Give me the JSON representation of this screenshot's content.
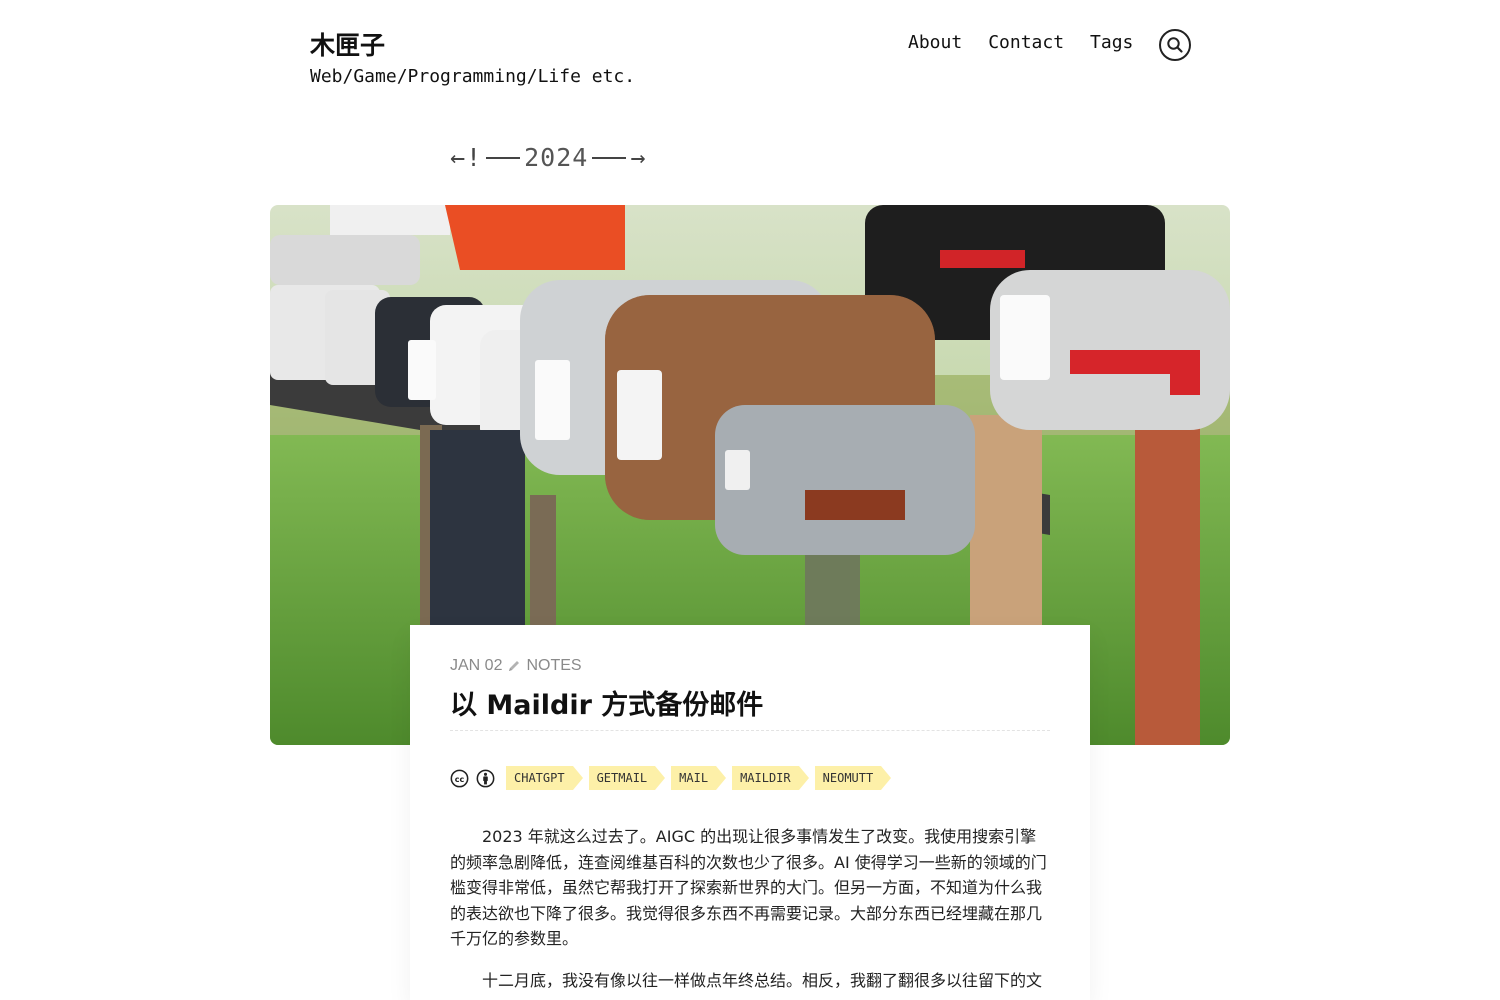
{
  "site": {
    "title": "木匣子",
    "description": "Web/Game/Programming/Life etc."
  },
  "nav": {
    "items": [
      "About",
      "Contact",
      "Tags"
    ]
  },
  "year_nav": {
    "left_arrow": "←!",
    "year": "2024",
    "right_arrow": "→"
  },
  "post": {
    "date": "JAN 02",
    "category": "NOTES",
    "title": "以 Maildir 方式备份邮件",
    "tags": [
      "CHATGPT",
      "GETMAIL",
      "MAIL",
      "MAILDIR",
      "NEOMUTT"
    ],
    "paragraphs": [
      "2023 年就这么过去了。AIGC 的出现让很多事情发生了改变。我使用搜索引擎的频率急剧降低，连查阅维基百科的次数也少了很多。AI 使得学习一些新的领域的门槛变得非常低，虽然它帮我打开了探索新世界的大门。但另一方面，不知道为什么我的表达欲也下降了很多。我觉得很多东西不再需要记录。大部分东西已经埋藏在那几千万亿的参数里。",
      "十二月底，我没有像以往一样做点年终总结。相反，我翻了翻很多以往留下的文"
    ]
  },
  "colors": {
    "tag_bg": "#fdf0a8",
    "meta_text": "#8a8a8a"
  }
}
